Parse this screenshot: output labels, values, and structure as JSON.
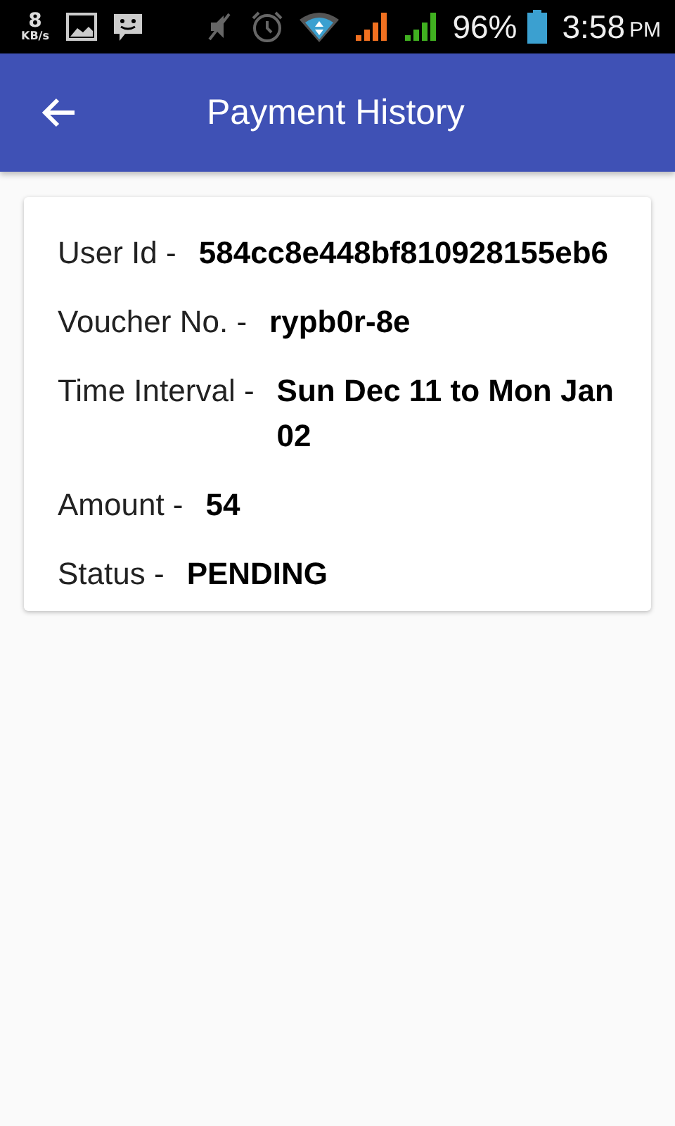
{
  "status_bar": {
    "speed": "8",
    "speed_unit": "KB/s",
    "battery": "96%",
    "time": "3:58",
    "ampm": "PM"
  },
  "app_bar": {
    "title": "Payment History"
  },
  "details": [
    {
      "label": "User Id -",
      "value": "584cc8e448bf810928155eb6"
    },
    {
      "label": "Voucher No. -",
      "value": "rypb0r-8e"
    },
    {
      "label": "Time Interval -",
      "value": "Sun Dec 11 to Mon Jan 02"
    },
    {
      "label": "Amount -",
      "value": "54"
    },
    {
      "label": "Status -",
      "value": "PENDING"
    }
  ]
}
